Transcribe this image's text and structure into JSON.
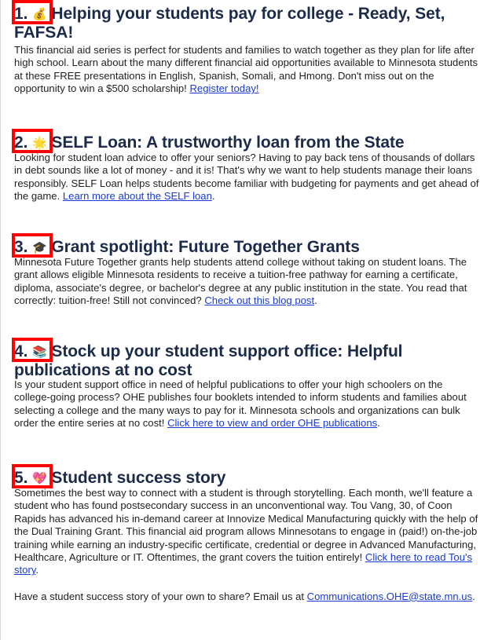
{
  "sections": [
    {
      "number": "1.",
      "icon": "money-bag-icon",
      "glyph": "💰",
      "title": "Helping your students pay for college - Ready, Set, FAFSA!",
      "body": "This financial aid series is perfect for students and families to watch together as they plan for life after high school. Learn about the many different financial aid opportunities available to Minnesota students at these FREE presentations in English, Spanish, Somali, and Hmong. Don't miss out on the opportunity to win a $500 scholarship! ",
      "link": "Register today!",
      "tail": ""
    },
    {
      "number": "2.",
      "icon": "star-icon",
      "glyph": "🌟",
      "title": "SELF Loan: A trustworthy loan from the State",
      "body": "Looking for student loan advice to offer your seniors? Having to pay back tens of thousands of dollars in debt sounds like a lot of money - and it is! That's why we want to help students manage their loans responsibly. SELF Loan helps students become familiar with budgeting for payments and get ahead of the game. ",
      "link": "Learn more about the SELF loan",
      "tail": "."
    },
    {
      "number": "3.",
      "icon": "graduation-cap-icon",
      "glyph": "🎓",
      "title": "Grant spotlight: Future Together Grants",
      "body": "Minnesota Future Together grants help students attend college without taking on student loans. The grant allows eligible Minnesota residents to receive a tuition-free pathway for earning a certificate, diploma, associate's degree, or bachelor's degree at any public institution in the state. You read that correctly: tuition-free! Still not convinced? ",
      "link": "Check out this blog post",
      "tail": "."
    },
    {
      "number": "4.",
      "icon": "books-icon",
      "glyph": "📚",
      "title": "Stock up your student support office: Helpful publications at no cost",
      "body": "Is your student support office in need of helpful publications to offer your high schoolers on the college-going process? OHE publishes four booklets intended to inform students and families about selecting a college and the many ways to pay for it. Minnesota schools and organizations can bulk order the entire series at no cost! ",
      "link": "Click here to view and order OHE publications",
      "tail": "."
    },
    {
      "number": "5.",
      "icon": "sparkling-heart-icon",
      "glyph": "💖",
      "title": "Student success story",
      "body": "Sometimes the best way to connect with a student is through storytelling. Each month, we'll feature a student who has found postsecondary success in an unconventional way. Tou Vang, 30, of Coon Rapids has advanced his in-demand career at Innovize Medical Manufacturing quickly with the help of the Dual Training Grant. This financial aid program allows Minnesotans to engage in (paid!) on-the-job training while earning an industry-specific certificate, credential or degree in Advanced Manufacturing, Healthcare, Agriculture or IT. Oftentimes, the grant covers the tuition entirely! ",
      "link": "Click here to read Tou's story",
      "tail": "."
    }
  ],
  "footer": {
    "text": "Have a student success story of your own to share? Email us at ",
    "email": "Communications.OHE@state.mn.us",
    "tail": "."
  },
  "colors": {
    "heading": "#1c2b4a",
    "link": "#1a3bd4",
    "highlight": "#ff0000"
  }
}
